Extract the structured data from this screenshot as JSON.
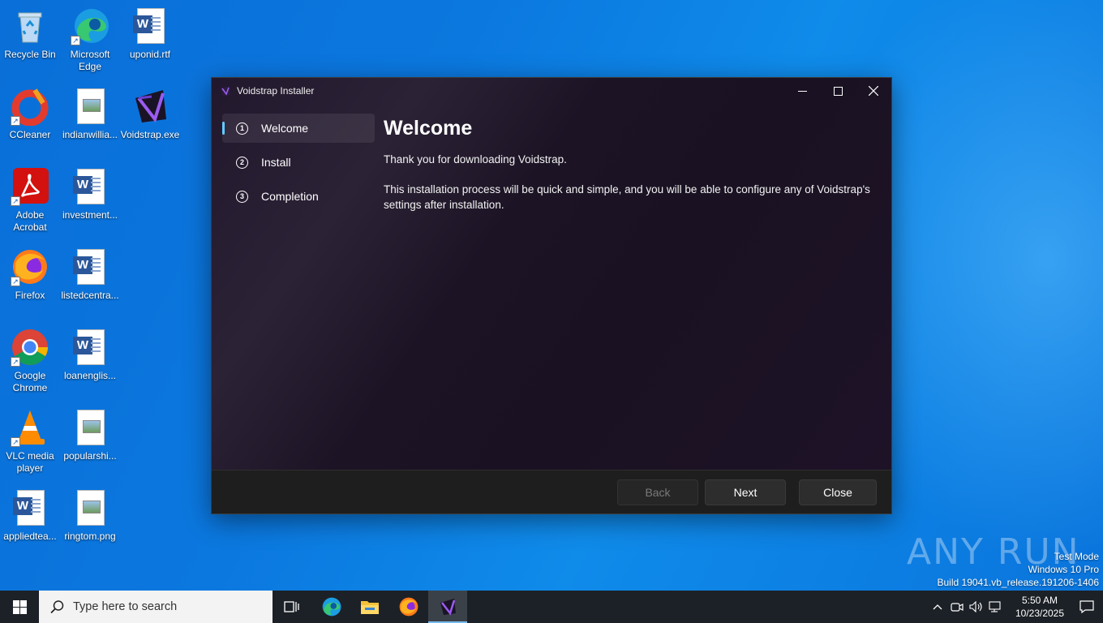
{
  "desktop": {
    "icons": [
      {
        "label": "Recycle Bin"
      },
      {
        "label": "Microsoft Edge"
      },
      {
        "label": "uponid.rtf"
      },
      {
        "label": "CCleaner"
      },
      {
        "label": "indianwillia..."
      },
      {
        "label": "Voidstrap.exe"
      },
      {
        "label": "Adobe Acrobat"
      },
      {
        "label": "investment..."
      },
      {
        "label": "Firefox"
      },
      {
        "label": "listedcentra..."
      },
      {
        "label": "Google Chrome"
      },
      {
        "label": "loanenglis..."
      },
      {
        "label": "VLC media player"
      },
      {
        "label": "popularshi..."
      },
      {
        "label": "appliedtea..."
      },
      {
        "label": "ringtom.png"
      }
    ]
  },
  "window": {
    "title": "Voidstrap Installer",
    "nav": [
      {
        "num": "1",
        "label": "Welcome"
      },
      {
        "num": "2",
        "label": "Install"
      },
      {
        "num": "3",
        "label": "Completion"
      }
    ],
    "heading": "Welcome",
    "para1": "Thank you for downloading Voidstrap.",
    "para2": "This installation process will be quick and simple, and you will be able to configure any of Voidstrap's settings after installation.",
    "buttons": {
      "back": "Back",
      "next": "Next",
      "close": "Close"
    }
  },
  "taskbar": {
    "search_placeholder": "Type here to search",
    "time": "5:50 AM",
    "date": "10/23/2025"
  },
  "watermark": {
    "brand": "ANY RUN",
    "line1": "Test Mode",
    "line2": "Windows 10 Pro",
    "line3": "Build 19041.vb_release.191206-1406"
  },
  "colors": {
    "accent": "#60cdff",
    "desktop": "#0b78df",
    "taskbar": "#1c2127"
  }
}
